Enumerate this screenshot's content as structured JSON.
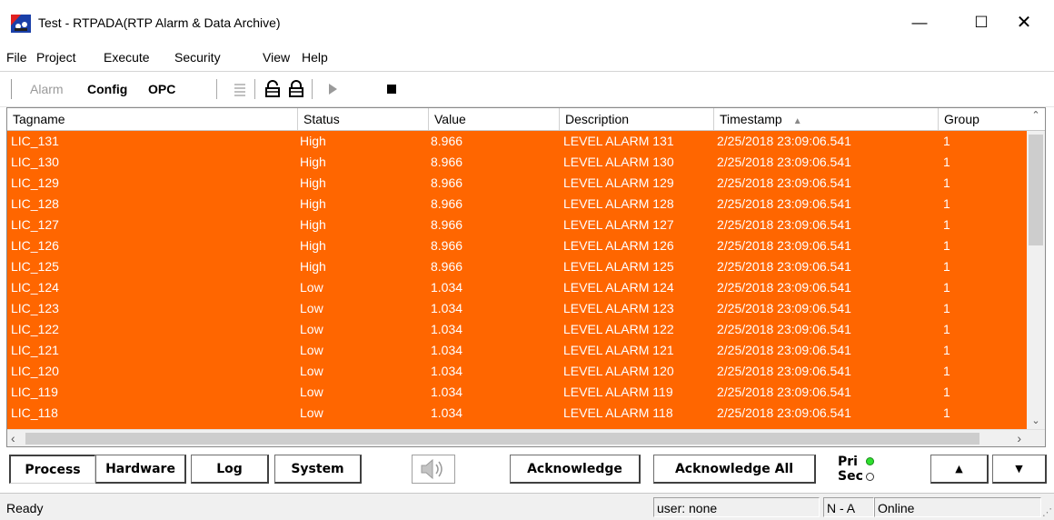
{
  "window": {
    "title": "Test - RTPADA(RTP Alarm & Data Archive)",
    "controls": {
      "minimize": "—",
      "maximize": "☐",
      "close": "✕"
    },
    "icon": "rtp-app-icon"
  },
  "menu": [
    "File",
    "Project",
    "Execute",
    "Security",
    "View",
    "Help"
  ],
  "toolbar": {
    "alarm": "Alarm",
    "config": "Config",
    "opc": "OPC",
    "icons": [
      "list-icon",
      "lock-open-icon",
      "lock-closed-icon",
      "play-icon",
      "stop-icon"
    ]
  },
  "table": {
    "columns": [
      "Tagname",
      "Status",
      "Value",
      "Description",
      "Timestamp",
      "Group"
    ],
    "sort_indicator": "▲",
    "row_color": "#ff6600",
    "rows": [
      [
        "LIC_131",
        "High",
        "8.966",
        "LEVEL ALARM 131",
        "2/25/2018 23:09:06.541",
        "1"
      ],
      [
        "LIC_130",
        "High",
        "8.966",
        "LEVEL ALARM 130",
        "2/25/2018 23:09:06.541",
        "1"
      ],
      [
        "LIC_129",
        "High",
        "8.966",
        "LEVEL ALARM 129",
        "2/25/2018 23:09:06.541",
        "1"
      ],
      [
        "LIC_128",
        "High",
        "8.966",
        "LEVEL ALARM 128",
        "2/25/2018 23:09:06.541",
        "1"
      ],
      [
        "LIC_127",
        "High",
        "8.966",
        "LEVEL ALARM 127",
        "2/25/2018 23:09:06.541",
        "1"
      ],
      [
        "LIC_126",
        "High",
        "8.966",
        "LEVEL ALARM 126",
        "2/25/2018 23:09:06.541",
        "1"
      ],
      [
        "LIC_125",
        "High",
        "8.966",
        "LEVEL ALARM 125",
        "2/25/2018 23:09:06.541",
        "1"
      ],
      [
        "LIC_124",
        "Low",
        "1.034",
        "LEVEL ALARM 124",
        "2/25/2018 23:09:06.541",
        "1"
      ],
      [
        "LIC_123",
        "Low",
        "1.034",
        "LEVEL ALARM 123",
        "2/25/2018 23:09:06.541",
        "1"
      ],
      [
        "LIC_122",
        "Low",
        "1.034",
        "LEVEL ALARM 122",
        "2/25/2018 23:09:06.541",
        "1"
      ],
      [
        "LIC_121",
        "Low",
        "1.034",
        "LEVEL ALARM 121",
        "2/25/2018 23:09:06.541",
        "1"
      ],
      [
        "LIC_120",
        "Low",
        "1.034",
        "LEVEL ALARM 120",
        "2/25/2018 23:09:06.541",
        "1"
      ],
      [
        "LIC_119",
        "Low",
        "1.034",
        "LEVEL ALARM 119",
        "2/25/2018 23:09:06.541",
        "1"
      ],
      [
        "LIC_118",
        "Low",
        "1.034",
        "LEVEL ALARM 118",
        "2/25/2018 23:09:06.541",
        "1"
      ]
    ]
  },
  "bottom": {
    "process": "Process",
    "hardware": "Hardware",
    "log": "Log",
    "system": "System",
    "acknowledge": "Acknowledge",
    "acknowledge_all": "Acknowledge All",
    "pri": "Pri",
    "sec": "Sec",
    "pri_color": "#2ee02e",
    "up": "▲",
    "down": "▼"
  },
  "status": {
    "ready": "Ready",
    "user": "user: none",
    "mode": "N - A",
    "connection": "Online"
  }
}
